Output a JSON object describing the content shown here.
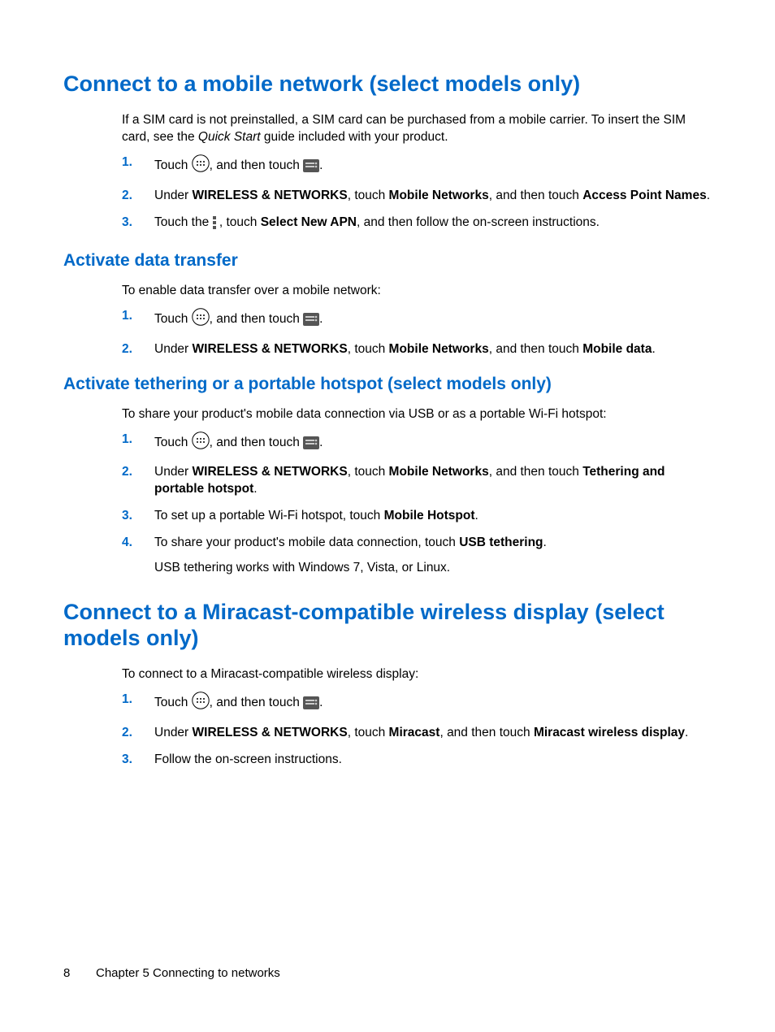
{
  "section1": {
    "heading": "Connect to a mobile network (select models only)",
    "intro_a": "If a SIM card is not preinstalled, a SIM card can be purchased from a mobile carrier. To insert the SIM card, see the ",
    "intro_em": "Quick Start",
    "intro_b": " guide included with your product.",
    "steps": {
      "s1a": "Touch ",
      "s1b": ", and then touch ",
      "s1c": ".",
      "s2a": "Under ",
      "s2b": "WIRELESS & NETWORKS",
      "s2c": ", touch ",
      "s2d": "Mobile Networks",
      "s2e": ", and then touch ",
      "s2f": "Access Point Names",
      "s2g": ".",
      "s3a": "Touch the ",
      "s3b": " , touch ",
      "s3c": "Select New APN",
      "s3d": ", and then follow the on-screen instructions."
    }
  },
  "section1a": {
    "heading": "Activate data transfer",
    "intro": "To enable data transfer over a mobile network:",
    "steps": {
      "s1a": "Touch ",
      "s1b": ", and then touch ",
      "s1c": ".",
      "s2a": "Under ",
      "s2b": "WIRELESS & NETWORKS",
      "s2c": ", touch ",
      "s2d": "Mobile Networks",
      "s2e": ", and then touch ",
      "s2f": "Mobile data",
      "s2g": "."
    }
  },
  "section1b": {
    "heading": "Activate tethering or a portable hotspot (select models only)",
    "intro": "To share your product's mobile data connection via USB or as a portable Wi-Fi hotspot:",
    "steps": {
      "s1a": "Touch ",
      "s1b": ", and then touch ",
      "s1c": ".",
      "s2a": "Under ",
      "s2b": "WIRELESS & NETWORKS",
      "s2c": ", touch ",
      "s2d": "Mobile Networks",
      "s2e": ", and then touch ",
      "s2f": "Tethering and portable hotspot",
      "s2g": ".",
      "s3a": "To set up a portable Wi-Fi hotspot, touch ",
      "s3b": "Mobile Hotspot",
      "s3c": ".",
      "s4a": "To share your product's mobile data connection, touch ",
      "s4b": "USB tethering",
      "s4c": ".",
      "s4sub": "USB tethering works with Windows 7, Vista, or Linux."
    }
  },
  "section2": {
    "heading": "Connect to a Miracast-compatible wireless display (select models only)",
    "intro": "To connect to a Miracast-compatible wireless display:",
    "steps": {
      "s1a": "Touch ",
      "s1b": ", and then touch ",
      "s1c": ".",
      "s2a": "Under ",
      "s2b": "WIRELESS & NETWORKS",
      "s2c": ", touch ",
      "s2d": "Miracast",
      "s2e": ", and then touch ",
      "s2f": "Miracast wireless display",
      "s2g": ".",
      "s3": "Follow the on-screen instructions."
    }
  },
  "footer": {
    "pageno": "8",
    "chapter": "Chapter 5   Connecting to networks"
  },
  "nums": {
    "n1": "1.",
    "n2": "2.",
    "n3": "3.",
    "n4": "4."
  }
}
